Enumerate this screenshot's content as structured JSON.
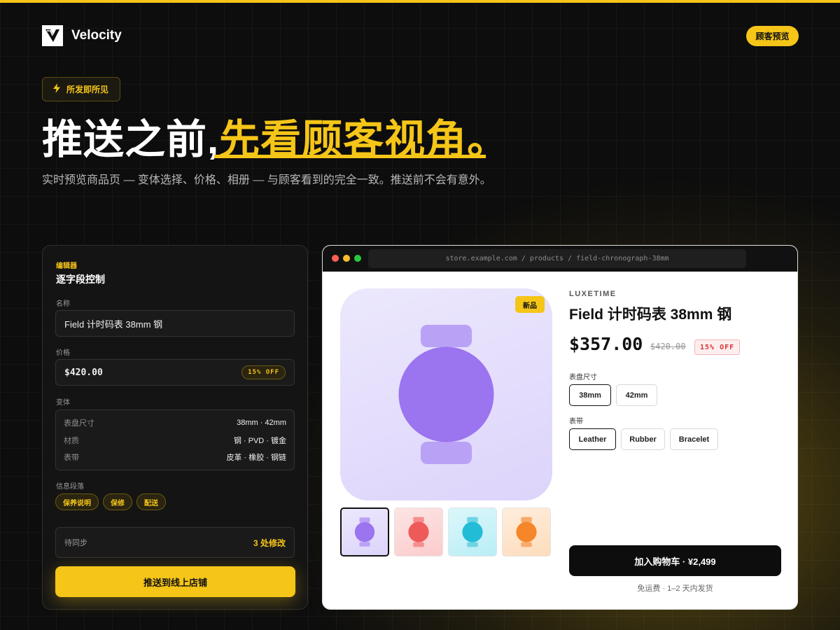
{
  "app": {
    "brand": "Velocity",
    "customer_preview_label": "顾客预览"
  },
  "hero": {
    "pill": "所发即所见",
    "title_plain": "推送之前,",
    "title_highlight": "先看顾客视角。",
    "subtitle": "实时预览商品页 — 变体选择、价格、相册 — 与顾客看到的完全一致。推送前不会有意外。"
  },
  "editor": {
    "kicker": "编辑器",
    "title": "逐字段控制",
    "name_label": "名称",
    "name_value": "Field 计时码表 38mm 钢",
    "price_label": "价格",
    "price_value": "$420.00",
    "price_badge": "15% OFF",
    "variants_label": "变体",
    "variants": [
      {
        "key": "表盘尺寸",
        "value": "38mm · 42mm"
      },
      {
        "key": "材质",
        "value": "钢 · PVD · 镀金"
      },
      {
        "key": "表带",
        "value": "皮革 · 橡胶 · 钢链"
      }
    ],
    "sections_label": "信息段落",
    "sections": [
      "保养说明",
      "保修",
      "配送"
    ],
    "sync_label": "待同步",
    "sync_count": "3  处修改",
    "push_label": "推送到线上店铺"
  },
  "browser": {
    "url": "store.example.com / products / field-chronograph-38mm",
    "badge": "新品",
    "vendor": "LUXETIME",
    "product_name": "Field 计时码表 38mm 钢",
    "price": "$357.00",
    "compare_price": "$420.00",
    "discount": "15% OFF",
    "size_label": "表盘尺寸",
    "sizes": [
      "38mm",
      "42mm"
    ],
    "selected_size": "38mm",
    "strap_label": "表带",
    "straps": [
      "Leather",
      "Rubber",
      "Bracelet"
    ],
    "selected_strap": "Leather",
    "cart_label": "加入购物车 · ¥2,499",
    "shipping_note": "免运费 · 1–2 天内发货",
    "thumbnail_colors": [
      "#9b74f0",
      "#ee5a5a",
      "#22bcd6",
      "#f5862a"
    ]
  },
  "colors": {
    "accent": "#f5c518",
    "background": "#0d0d0d",
    "watch_purple": "#9b74f0"
  }
}
